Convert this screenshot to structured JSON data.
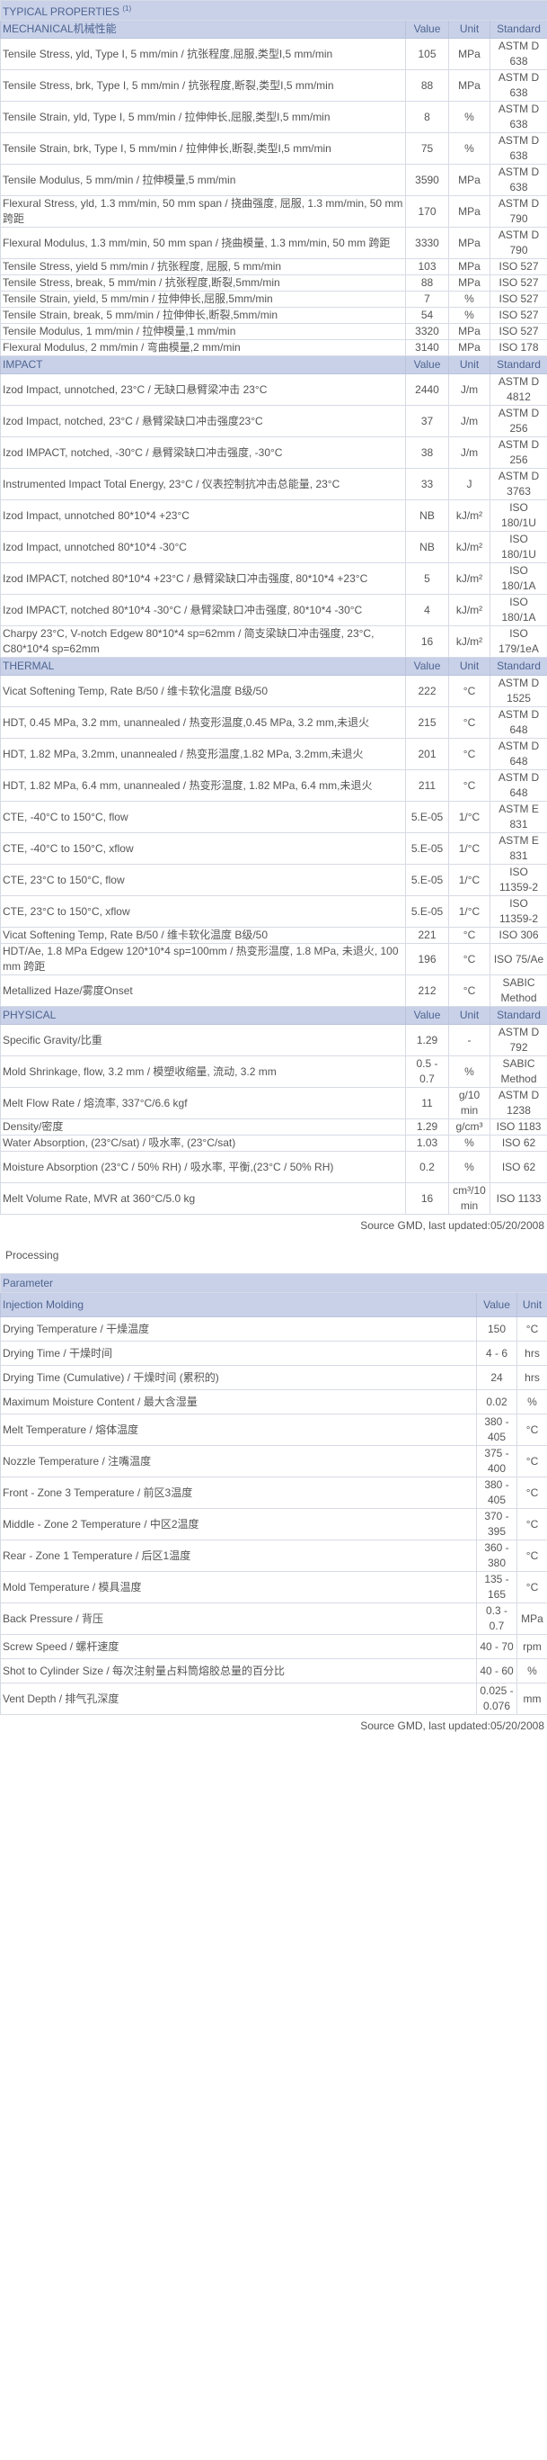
{
  "typical_title": "TYPICAL PROPERTIES",
  "typical_sup": "(1)",
  "headers": {
    "value": "Value",
    "unit": "Unit",
    "standard": "Standard"
  },
  "sections": [
    {
      "name": "MECHANICAL机械性能",
      "rows": [
        {
          "p": "Tensile Stress, yld, Type I, 5 mm/min / 抗张程度,屈服,类型I,5 mm/min",
          "v": "105",
          "u": "MPa",
          "s": "ASTM D 638"
        },
        {
          "p": "Tensile Stress, brk, Type I, 5 mm/min / 抗张程度,断裂,类型I,5 mm/min",
          "v": "88",
          "u": "MPa",
          "s": "ASTM D 638"
        },
        {
          "p": "Tensile Strain, yld, Type I, 5 mm/min / 拉伸伸长,屈服,类型I,5 mm/min",
          "v": "8",
          "u": "%",
          "s": "ASTM D 638"
        },
        {
          "p": "Tensile Strain, brk, Type I, 5 mm/min / 拉伸伸长,断裂,类型I,5 mm/min",
          "v": "75",
          "u": "%",
          "s": "ASTM D 638"
        },
        {
          "p": "Tensile Modulus, 5 mm/min / 拉伸模量,5 mm/min",
          "v": "3590",
          "u": "MPa",
          "s": "ASTM D 638"
        },
        {
          "p": "Flexural Stress, yld, 1.3 mm/min, 50 mm span / 挠曲强度, 屈服, 1.3 mm/min, 50 mm 跨距",
          "v": "170",
          "u": "MPa",
          "s": "ASTM D 790"
        },
        {
          "p": "Flexural Modulus, 1.3 mm/min, 50 mm span / 挠曲模量, 1.3 mm/min, 50 mm 跨距",
          "v": "3330",
          "u": "MPa",
          "s": "ASTM D 790"
        },
        {
          "p": "Tensile Stress, yield 5 mm/min / 抗张程度, 屈服, 5 mm/min",
          "v": "103",
          "u": "MPa",
          "s": "ISO 527"
        },
        {
          "p": "Tensile Stress, break, 5 mm/min / 抗张程度,断裂,5mm/min",
          "v": "88",
          "u": "MPa",
          "s": "ISO 527"
        },
        {
          "p": "Tensile Strain, yield, 5 mm/min / 拉伸伸长,屈服,5mm/min",
          "v": "7",
          "u": "%",
          "s": "ISO 527"
        },
        {
          "p": "Tensile Strain, break, 5 mm/min / 拉伸伸长,断裂,5mm/min",
          "v": "54",
          "u": "%",
          "s": "ISO 527"
        },
        {
          "p": "Tensile Modulus, 1 mm/min / 拉伸模量,1 mm/min",
          "v": "3320",
          "u": "MPa",
          "s": "ISO 527"
        },
        {
          "p": "Flexural Modulus, 2 mm/min / 弯曲模量,2 mm/min",
          "v": "3140",
          "u": "MPa",
          "s": "ISO 178"
        }
      ]
    },
    {
      "name": "IMPACT",
      "rows": [
        {
          "p": "Izod Impact, unnotched, 23°C / 无缺口悬臂梁冲击 23°C",
          "v": "2440",
          "u": "J/m",
          "s": "ASTM D 4812"
        },
        {
          "p": "Izod Impact, notched, 23°C / 悬臂梁缺口冲击强度23°C",
          "v": "37",
          "u": "J/m",
          "s": "ASTM D 256"
        },
        {
          "p": "Izod IMPACT, notched, -30°C / 悬臂梁缺口冲击强度, -30°C",
          "v": "38",
          "u": "J/m",
          "s": "ASTM D 256"
        },
        {
          "p": "Instrumented Impact Total Energy, 23°C / 仪表控制抗冲击总能量, 23°C",
          "v": "33",
          "u": "J",
          "s": "ASTM D 3763"
        },
        {
          "p": "Izod Impact, unnotched 80*10*4 +23°C",
          "v": "NB",
          "u": "kJ/m²",
          "s": "ISO 180/1U"
        },
        {
          "p": "Izod Impact, unnotched 80*10*4 -30°C",
          "v": "NB",
          "u": "kJ/m²",
          "s": "ISO 180/1U"
        },
        {
          "p": "Izod IMPACT, notched 80*10*4 +23°C / 悬臂梁缺口冲击强度, 80*10*4 +23°C",
          "v": "5",
          "u": "kJ/m²",
          "s": "ISO 180/1A"
        },
        {
          "p": "Izod IMPACT, notched 80*10*4 -30°C / 悬臂梁缺口冲击强度, 80*10*4 -30°C",
          "v": "4",
          "u": "kJ/m²",
          "s": "ISO 180/1A"
        },
        {
          "p": "Charpy 23°C, V-notch Edgew 80*10*4 sp=62mm / 简支梁缺口冲击强度, 23°C, C80*10*4 sp=62mm",
          "v": "16",
          "u": "kJ/m²",
          "s": "ISO 179/1eA"
        }
      ]
    },
    {
      "name": "THERMAL",
      "rows": [
        {
          "p": "Vicat Softening Temp, Rate B/50 / 维卡软化温度 B级/50",
          "v": "222",
          "u": "°C",
          "s": "ASTM D 1525"
        },
        {
          "p": "HDT, 0.45 MPa, 3.2 mm, unannealed / 热变形温度,0.45 MPa, 3.2 mm,未退火",
          "v": "215",
          "u": "°C",
          "s": "ASTM D 648"
        },
        {
          "p": "HDT, 1.82 MPa, 3.2mm, unannealed / 热变形温度,1.82 MPa, 3.2mm,未退火",
          "v": "201",
          "u": "°C",
          "s": "ASTM D 648"
        },
        {
          "p": "HDT, 1.82 MPa, 6.4 mm, unannealed / 热变形温度, 1.82 MPa, 6.4 mm,未退火",
          "v": "211",
          "u": "°C",
          "s": "ASTM D 648"
        },
        {
          "p": "CTE, -40°C to 150°C, flow",
          "v": "5.E-05",
          "u": "1/°C",
          "s": "ASTM E 831"
        },
        {
          "p": "CTE, -40°C to 150°C, xflow",
          "v": "5.E-05",
          "u": "1/°C",
          "s": "ASTM E 831"
        },
        {
          "p": "CTE, 23°C to 150°C, flow",
          "v": "5.E-05",
          "u": "1/°C",
          "s": "ISO 11359-2"
        },
        {
          "p": "CTE, 23°C to 150°C, xflow",
          "v": "5.E-05",
          "u": "1/°C",
          "s": "ISO 11359-2"
        },
        {
          "p": "Vicat Softening Temp, Rate B/50 / 维卡软化温度 B级/50",
          "v": "221",
          "u": "°C",
          "s": "ISO 306"
        },
        {
          "p": "HDT/Ae, 1.8 MPa Edgew 120*10*4 sp=100mm / 热变形温度, 1.8 MPa, 未退火, 100 mm 跨距",
          "v": "196",
          "u": "°C",
          "s": "ISO 75/Ae"
        },
        {
          "p": "Metallized Haze/雾度Onset",
          "v": "212",
          "u": "°C",
          "s": "SABIC Method"
        }
      ]
    },
    {
      "name": "PHYSICAL",
      "rows": [
        {
          "p": "Specific Gravity/比重",
          "v": "1.29",
          "u": "-",
          "s": "ASTM D 792"
        },
        {
          "p": "Mold Shrinkage, flow, 3.2 mm / 模塑收缩量, 流动, 3.2 mm",
          "v": "0.5 - 0.7",
          "u": "%",
          "s": "SABIC Method"
        },
        {
          "p": "Melt Flow Rate / 熔流率, 337°C/6.6 kgf",
          "v": "11",
          "u": "g/10 min",
          "s": "ASTM D 1238"
        },
        {
          "p": "Density/密度",
          "v": "1.29",
          "u": "g/cm³",
          "s": "ISO 1183"
        },
        {
          "p": "Water Absorption, (23°C/sat) / 吸水率, (23°C/sat)",
          "v": "1.03",
          "u": "%",
          "s": "ISO 62"
        },
        {
          "p": "Moisture Absorption (23°C / 50% RH) / 吸水率, 平衡,(23°C / 50% RH)",
          "v": "0.2",
          "u": "%",
          "s": "ISO 62"
        },
        {
          "p": "Melt Volume Rate, MVR at 360°C/5.0 kg",
          "v": "16",
          "u": "cm³/10 min",
          "s": "ISO 1133"
        }
      ]
    }
  ],
  "source_note": "Source GMD, last updated:05/20/2008",
  "processing": {
    "title": "Processing",
    "param_header": "Parameter",
    "section_name": "Injection Molding",
    "value_header": "Value",
    "unit_header": "Unit",
    "rows": [
      {
        "p": "Drying Temperature / 干燥温度",
        "v": "150",
        "u": "°C"
      },
      {
        "p": "Drying Time / 干燥时间",
        "v": "4 - 6",
        "u": "hrs"
      },
      {
        "p": "Drying Time (Cumulative) / 干燥时间 (累积的)",
        "v": "24",
        "u": "hrs"
      },
      {
        "p": "Maximum Moisture Content / 最大含湿量",
        "v": "0.02",
        "u": "%"
      },
      {
        "p": "Melt Temperature / 熔体温度",
        "v": "380 - 405",
        "u": "°C"
      },
      {
        "p": "Nozzle Temperature / 注嘴温度",
        "v": "375 - 400",
        "u": "°C"
      },
      {
        "p": "Front - Zone 3 Temperature / 前区3温度",
        "v": "380 - 405",
        "u": "°C"
      },
      {
        "p": "Middle - Zone 2 Temperature / 中区2温度",
        "v": "370 - 395",
        "u": "°C"
      },
      {
        "p": "Rear - Zone 1 Temperature / 后区1温度",
        "v": "360 - 380",
        "u": "°C"
      },
      {
        "p": "Mold Temperature / 模具温度",
        "v": "135 - 165",
        "u": "°C"
      },
      {
        "p": "Back Pressure / 背压",
        "v": "0.3 - 0.7",
        "u": "MPa"
      },
      {
        "p": "Screw Speed / 螺杆速度",
        "v": "40 - 70",
        "u": "rpm"
      },
      {
        "p": "Shot to Cylinder Size / 每次注射量占料筒熔胶总量的百分比",
        "v": "40 - 60",
        "u": "%"
      },
      {
        "p": "Vent Depth / 排气孔深度",
        "v": "0.025 - 0.076",
        "u": "mm"
      }
    ]
  },
  "processing_source_note": "Source GMD, last updated:05/20/2008"
}
